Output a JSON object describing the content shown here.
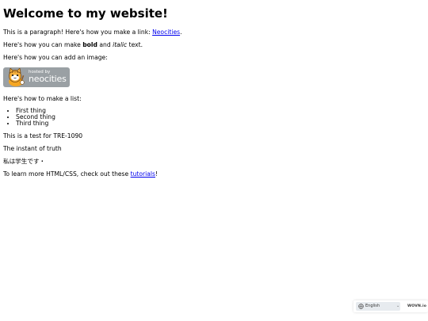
{
  "page": {
    "heading": "Welcome to my website!",
    "p1_text": "This is a paragraph! Here's how you make a link: ",
    "p1_link": "Neocities",
    "p1_end": ".",
    "p2_pre": "Here's how you can make ",
    "p2_bold": "bold",
    "p2_mid": " and ",
    "p2_italic": "italic",
    "p2_end": " text.",
    "p3_text": "Here's how you can add an image:",
    "badge": {
      "hosted": "hosted by",
      "brand": "neocities",
      "bg_color": "#9aa0a4"
    },
    "p4_text": "Here's how to make a list:",
    "list": [
      "First thing",
      "Second thing",
      "Third thing"
    ],
    "p5_text": "This is a test for TRE-1090",
    "p6_text": "The instant of truth",
    "p7_text": "私は学生です・",
    "p8_pre": "To learn more HTML/CSS, check out these ",
    "p8_link": "tutorials",
    "p8_end": "!"
  },
  "language_widget": {
    "selected": "English",
    "chevron": "⌄",
    "brand": "WOVN.io",
    "icon": "globe-icon"
  },
  "colors": {
    "link": "#0000ee",
    "widget_select_bg": "#e7ebef"
  }
}
